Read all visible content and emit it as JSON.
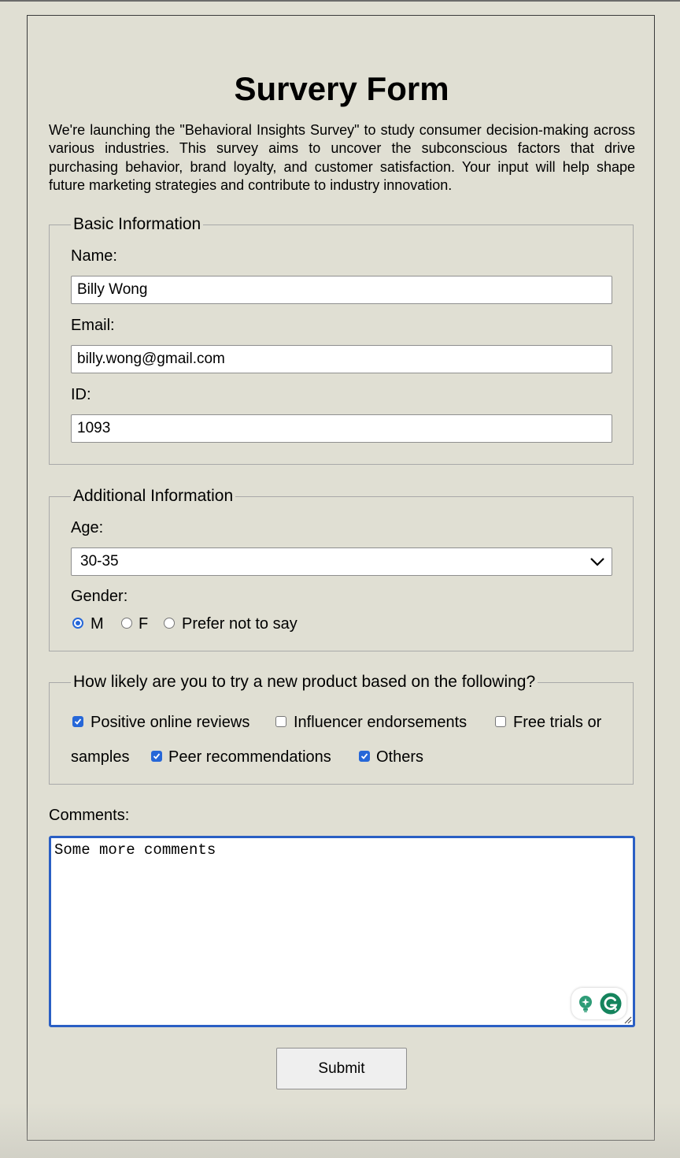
{
  "form": {
    "title": "Survery Form",
    "intro": "We're launching the \"Behavioral Insights Survey\" to study consumer decision-making across various industries. This survey aims to uncover the subconscious factors that drive purchasing behavior, brand loyalty, and customer satisfaction. Your input will help shape future marketing strategies and contribute to industry innovation."
  },
  "basic": {
    "legend": "Basic Information",
    "name_label": "Name:",
    "name_value": "Billy Wong",
    "email_label": "Email:",
    "email_value": "billy.wong@gmail.com",
    "id_label": "ID:",
    "id_value": "1093"
  },
  "additional": {
    "legend": "Additional Information",
    "age_label": "Age:",
    "age_value": "30-35",
    "gender_label": "Gender:",
    "gender_options": [
      {
        "label": "M",
        "checked": true
      },
      {
        "label": "F",
        "checked": false
      },
      {
        "label": "Prefer not to say",
        "checked": false
      }
    ]
  },
  "likelihood": {
    "legend": "How likely are you to try a new product based on the following?",
    "options": [
      {
        "label": "Positive online reviews",
        "checked": true
      },
      {
        "label": "Influencer endorsements",
        "checked": false
      },
      {
        "label": "Free trials or",
        "checked": false
      },
      {
        "label": "samples",
        "checked": false
      },
      {
        "label": "Peer recommendations",
        "checked": true
      },
      {
        "label": "Others",
        "checked": true
      }
    ]
  },
  "comments": {
    "label": "Comments:",
    "value": "Some more comments"
  },
  "submit_label": "Submit",
  "colors": {
    "background": "#e0dfd3",
    "accent": "#2667d8",
    "grammarly": "#15845d"
  }
}
